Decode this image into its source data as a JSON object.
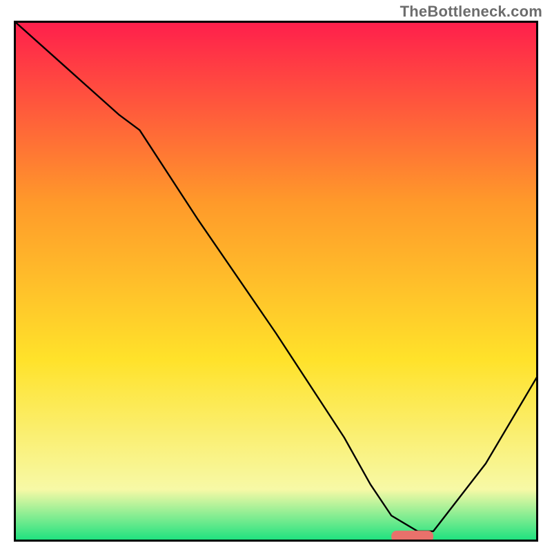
{
  "watermark": "TheBottleneck.com",
  "chart_data": {
    "type": "line",
    "title": "",
    "xlabel": "",
    "ylabel": "",
    "xlim": [
      0,
      100
    ],
    "ylim": [
      0,
      100
    ],
    "grid": false,
    "legend": false,
    "background_gradient": {
      "top": "#ff1e4c",
      "upper_mid": "#ff9a2a",
      "mid": "#ffe22a",
      "lower_mid": "#f7f9a6",
      "bottom": "#17e17e"
    },
    "series": [
      {
        "name": "bottleneck-curve",
        "x": [
          0,
          10,
          20,
          24,
          35,
          50,
          63,
          68,
          72,
          77,
          80,
          90,
          100
        ],
        "values": [
          100,
          91,
          82,
          79,
          62,
          40,
          20,
          11,
          5,
          2,
          2,
          15,
          32
        ]
      }
    ],
    "marker": {
      "name": "optimal-range",
      "x_start": 72,
      "x_end": 80,
      "y": 1,
      "color": "#e9716b"
    }
  }
}
